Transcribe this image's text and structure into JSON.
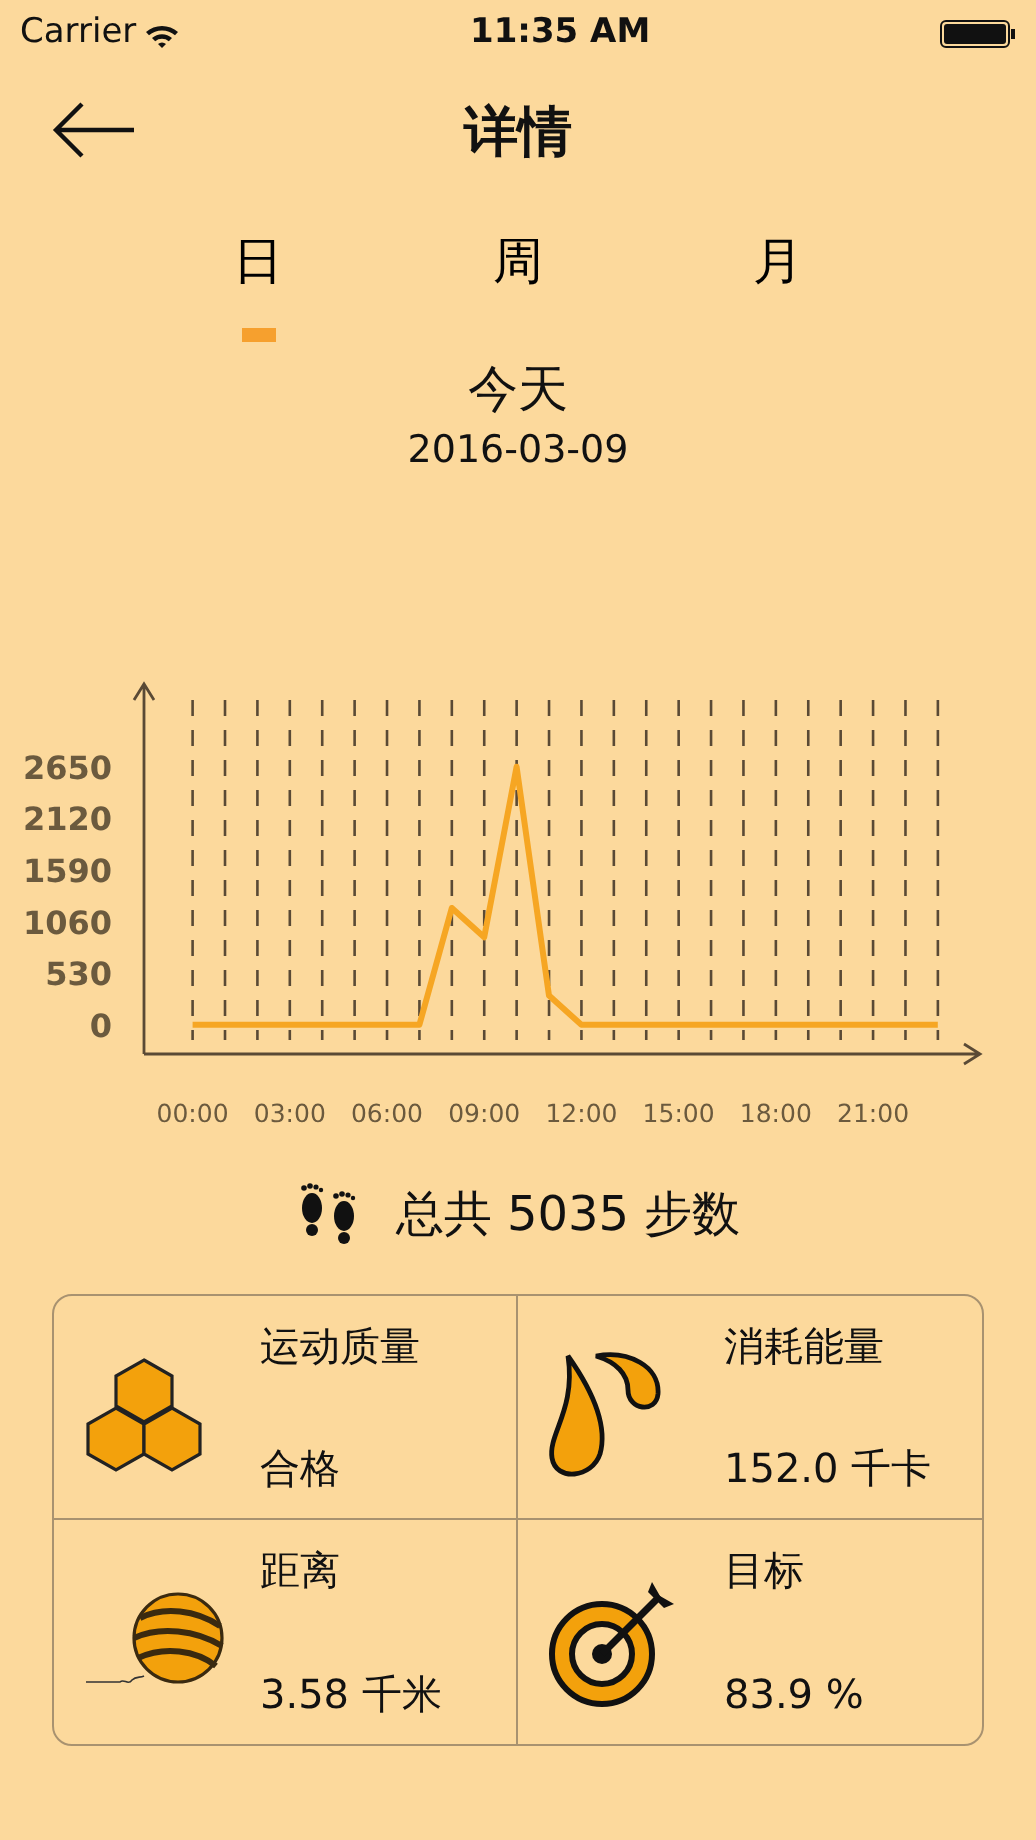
{
  "status_bar": {
    "carrier": "Carrier",
    "time": "11:35 AM"
  },
  "nav": {
    "title": "详情"
  },
  "tabs": [
    {
      "label": "日",
      "selected": true
    },
    {
      "label": "周",
      "selected": false
    },
    {
      "label": "月",
      "selected": false
    }
  ],
  "period": {
    "title": "今天",
    "date": "2016-03-09"
  },
  "chart_data": {
    "type": "line",
    "x": [
      0,
      1,
      2,
      3,
      4,
      5,
      6,
      7,
      8,
      9,
      10,
      11,
      12,
      13,
      14,
      15,
      16,
      17,
      18,
      19,
      20,
      21,
      22,
      23
    ],
    "series": [
      {
        "color": "#f6a623",
        "values": [
          0,
          0,
          0,
          0,
          0,
          0,
          0,
          0,
          1200,
          900,
          2650,
          300,
          0,
          0,
          0,
          0,
          0,
          0,
          0,
          0,
          0,
          0,
          0,
          0
        ]
      }
    ],
    "xlim": [
      -1.5,
      24.3
    ],
    "grid": true,
    "xticks": [
      {
        "value": 0,
        "label": "00:00"
      },
      {
        "value": 3,
        "label": "03:00"
      },
      {
        "value": 6,
        "label": "06:00"
      },
      {
        "value": 9,
        "label": "09:00"
      },
      {
        "value": 12,
        "label": "12:00"
      },
      {
        "value": 15,
        "label": "15:00"
      },
      {
        "value": 18,
        "label": "18:00"
      },
      {
        "value": 21,
        "label": "21:00"
      }
    ],
    "yticks": [
      0,
      530,
      1060,
      1590,
      2120,
      2650
    ],
    "ylim": [
      -300,
      3500
    ]
  },
  "total": {
    "text": "总共 5035 步数"
  },
  "stats": [
    {
      "kind": "quality",
      "label": "运动质量",
      "value": "合格"
    },
    {
      "kind": "energy",
      "label": "消耗能量",
      "value": "152.0 千卡"
    },
    {
      "kind": "distance",
      "label": "距离",
      "value": "3.58 千米"
    },
    {
      "kind": "goal",
      "label": "目标",
      "value": "83.9 %"
    }
  ]
}
